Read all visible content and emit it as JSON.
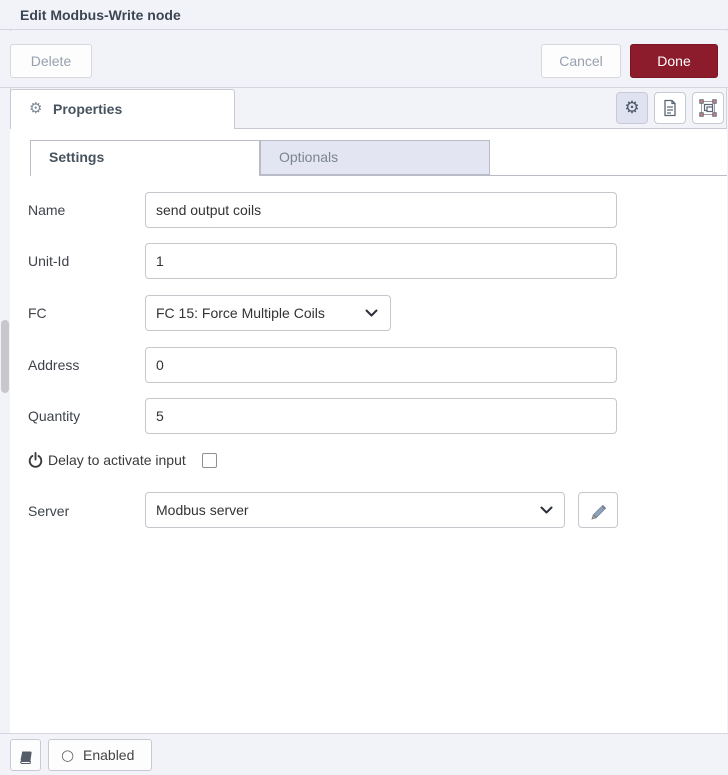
{
  "colors": {
    "done_button_bg": "#8c1c2b",
    "chrome_bg": "#f2f3f9",
    "inactive_tab_bg": "#e3e6f2",
    "input_border": "#c6c6cc"
  },
  "icons": {
    "gear_glyph": "⚙",
    "circle_glyph": "○",
    "properties_tab_icon": "gear",
    "editor_tabs": [
      "gear",
      "document",
      "appearance-frame"
    ],
    "delay_icon": "power",
    "server_edit_icon": "pencil",
    "footer_icon": "book"
  },
  "header": {
    "title": "Edit Modbus-Write node"
  },
  "toolbar": {
    "delete_label": "Delete",
    "cancel_label": "Cancel",
    "done_label": "Done"
  },
  "tabs": {
    "properties_label": "Properties"
  },
  "subtabs": {
    "settings_label": "Settings",
    "optionals_label": "Optionals"
  },
  "form": {
    "name": {
      "label": "Name",
      "value": "send output coils"
    },
    "unit_id": {
      "label": "Unit-Id",
      "value": "1"
    },
    "fc": {
      "label": "FC",
      "value": "FC 15: Force Multiple Coils"
    },
    "address": {
      "label": "Address",
      "value": "0"
    },
    "quantity": {
      "label": "Quantity",
      "value": "5"
    },
    "delay": {
      "label": "Delay to activate input",
      "checked": false
    },
    "server": {
      "label": "Server",
      "value": "Modbus server"
    }
  },
  "footer": {
    "enabled_label": "Enabled"
  }
}
